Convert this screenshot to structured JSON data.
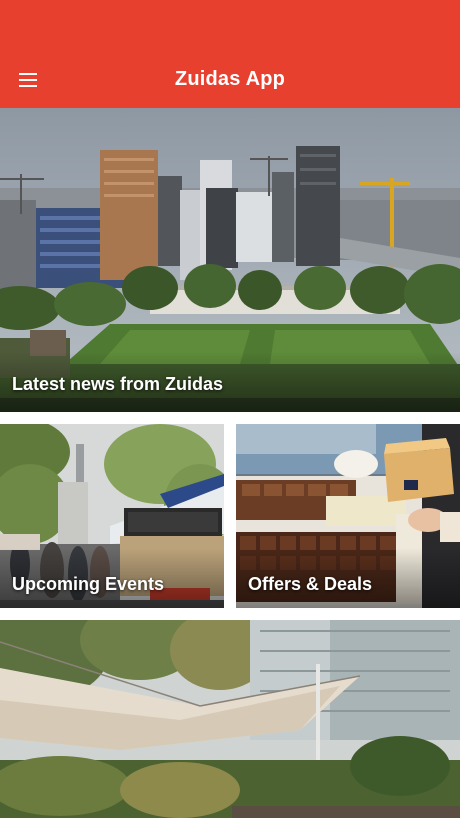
{
  "header": {
    "title": "Zuidas App",
    "menu_icon": "hamburger-menu-icon",
    "background": "#e8402f"
  },
  "tiles": [
    {
      "label": "Latest news from Zuidas"
    },
    {
      "label": "Upcoming Events"
    },
    {
      "label": "Offers & Deals"
    },
    {
      "label": ""
    }
  ]
}
